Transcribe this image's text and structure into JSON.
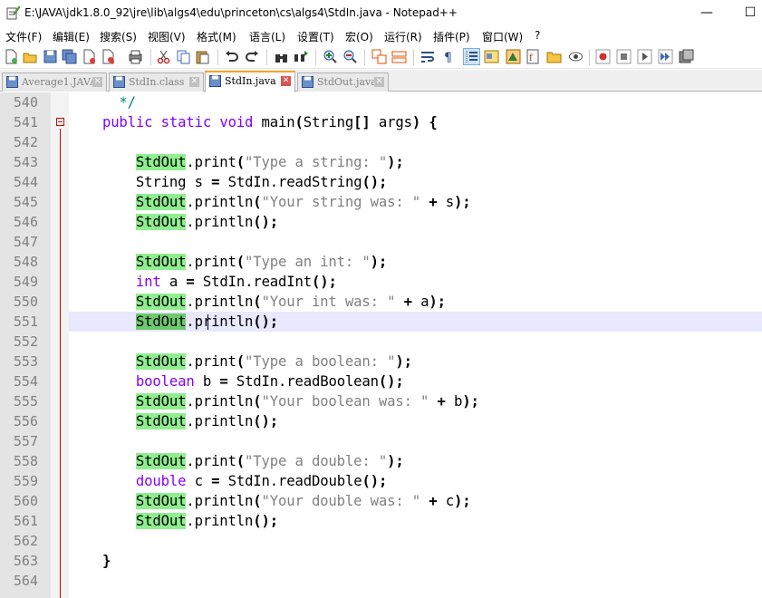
{
  "window": {
    "title": "E:\\JAVA\\jdk1.8.0_92\\jre\\lib\\algs4\\edu\\princeton\\cs\\algs4\\StdIn.java - Notepad++",
    "minimize_glyph": "—",
    "maximize_glyph": "☐"
  },
  "menu": [
    "文件(F)",
    "编辑(E)",
    "搜索(S)",
    "视图(V)",
    "格式(M)",
    "语言(L)",
    "设置(T)",
    "宏(O)",
    "运行(R)",
    "插件(P)",
    "窗口(W)",
    "?"
  ],
  "tabs": [
    {
      "label": "Average1.JAVA",
      "active": false
    },
    {
      "label": "StdIn.class",
      "active": false
    },
    {
      "label": "StdIn.java",
      "active": true
    },
    {
      "label": "StdOut.java",
      "active": false
    }
  ],
  "tab_close_glyph": "✕",
  "colors": {
    "keyword": "#8000ff",
    "string": "#808080",
    "highlight": "#8fef8f",
    "fold_marker": "#d40000",
    "active_tab_accent": "#f5a623",
    "current_line": "#e8e8ff"
  },
  "editor": {
    "lines": [
      {
        "n": "540",
        "code": "      */"
      },
      {
        "n": "541",
        "code": "    public static void main(String[] args) {"
      },
      {
        "n": "542",
        "code": ""
      },
      {
        "n": "543",
        "code": "        StdOut.print(\"Type a string: \");"
      },
      {
        "n": "544",
        "code": "        String s = StdIn.readString();"
      },
      {
        "n": "545",
        "code": "        StdOut.println(\"Your string was: \" + s);"
      },
      {
        "n": "546",
        "code": "        StdOut.println();"
      },
      {
        "n": "547",
        "code": ""
      },
      {
        "n": "548",
        "code": "        StdOut.print(\"Type an int: \");"
      },
      {
        "n": "549",
        "code": "        int a = StdIn.readInt();"
      },
      {
        "n": "550",
        "code": "        StdOut.println(\"Your int was: \" + a);"
      },
      {
        "n": "551",
        "code": "        StdOut.println();"
      },
      {
        "n": "552",
        "code": ""
      },
      {
        "n": "553",
        "code": "        StdOut.print(\"Type a boolean: \");"
      },
      {
        "n": "554",
        "code": "        boolean b = StdIn.readBoolean();"
      },
      {
        "n": "555",
        "code": "        StdOut.println(\"Your boolean was: \" + b);"
      },
      {
        "n": "556",
        "code": "        StdOut.println();"
      },
      {
        "n": "557",
        "code": ""
      },
      {
        "n": "558",
        "code": "        StdOut.print(\"Type a double: \");"
      },
      {
        "n": "559",
        "code": "        double c = StdIn.readDouble();"
      },
      {
        "n": "560",
        "code": "        StdOut.println(\"Your double was: \" + c);"
      },
      {
        "n": "561",
        "code": "        StdOut.println();"
      },
      {
        "n": "562",
        "code": ""
      },
      {
        "n": "563",
        "code": "    }"
      },
      {
        "n": "564",
        "code": ""
      }
    ],
    "current_line": "551",
    "highlighted_word": "StdOut"
  }
}
